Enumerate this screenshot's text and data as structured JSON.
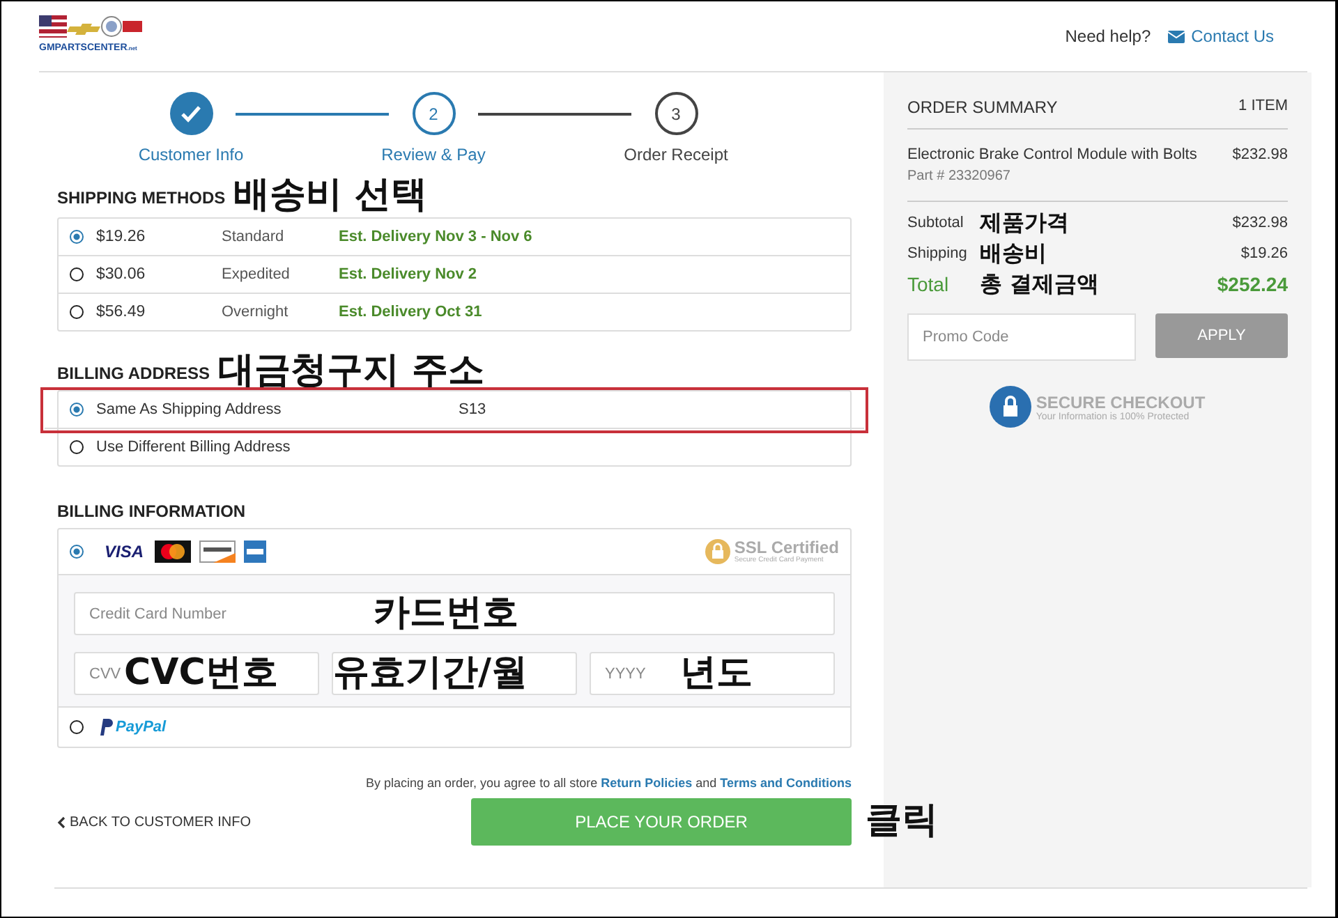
{
  "header": {
    "logo_text": "GMPARTSCENTER",
    "logo_suffix": ".net",
    "help": "Need help?",
    "contact": "Contact Us"
  },
  "steps": [
    {
      "label": "Customer Info",
      "completed": true,
      "selected": false
    },
    {
      "label": "Review & Pay",
      "number": "2",
      "completed": false,
      "selected": true
    },
    {
      "label": "Order Receipt",
      "number": "3",
      "completed": false,
      "selected": false
    }
  ],
  "shipping": {
    "title": "SHIPPING METHODS",
    "annotation": "배송비 선택",
    "options": [
      {
        "price": "$19.26",
        "name": "Standard",
        "delivery": "Est. Delivery Nov 3 - Nov 6",
        "selected": true
      },
      {
        "price": "$30.06",
        "name": "Expedited",
        "delivery": "Est. Delivery Nov 2",
        "selected": false
      },
      {
        "price": "$56.49",
        "name": "Overnight",
        "delivery": "Est. Delivery Oct 31",
        "selected": false
      }
    ]
  },
  "billing_address": {
    "title": "BILLING ADDRESS",
    "annotation": "대금청구지 주소",
    "options": [
      {
        "label": "Same As Shipping Address",
        "detail": "S13",
        "selected": true,
        "highlighted": true
      },
      {
        "label": "Use Different Billing Address",
        "selected": false,
        "highlighted": false
      }
    ]
  },
  "billing_info": {
    "title": "BILLING INFORMATION",
    "card": {
      "selected": true,
      "visa": "VISA",
      "ssl_title": "SSL Certified",
      "ssl_subtitle": "Secure Credit Card Payment",
      "number_field": {
        "placeholder": "Credit Card Number",
        "annotation": "카드번호"
      },
      "short_fields": [
        {
          "placeholder": "CVV",
          "annotation": "CVC번호"
        },
        {
          "annotation": "유효기간/월"
        },
        {
          "placeholder": "YYYY",
          "annotation": "년도"
        }
      ]
    },
    "paypal": {
      "selected": false,
      "label": "PayPal"
    }
  },
  "agreement": {
    "prefix": "By placing an order, you agree to all store",
    "link1": "Return Policies",
    "middle": "and",
    "link2": "Terms and Conditions"
  },
  "back_link": "BACK TO CUSTOMER INFO",
  "place_order": "PLACE YOUR ORDER",
  "place_order_annotation": "클릭",
  "summary": {
    "title": "ORDER SUMMARY",
    "count": "1 ITEM",
    "item": {
      "name": "Electronic Brake Control Module with Bolts",
      "price": "$232.98",
      "part": "Part # 23320967"
    },
    "rows": [
      {
        "label": "Subtotal",
        "annotation": "제품가격",
        "value": "$232.98",
        "kind": "normal"
      },
      {
        "label": "Shipping",
        "annotation": "배송비",
        "value": "$19.26",
        "kind": "normal"
      },
      {
        "label": "Total",
        "annotation": "총 결제금액",
        "value": "$252.24",
        "kind": "total"
      }
    ],
    "promo_placeholder": "Promo Code",
    "apply": "APPLY",
    "secure_title": "SECURE CHECKOUT",
    "secure_subtitle": "Your Information is 100% Protected"
  }
}
